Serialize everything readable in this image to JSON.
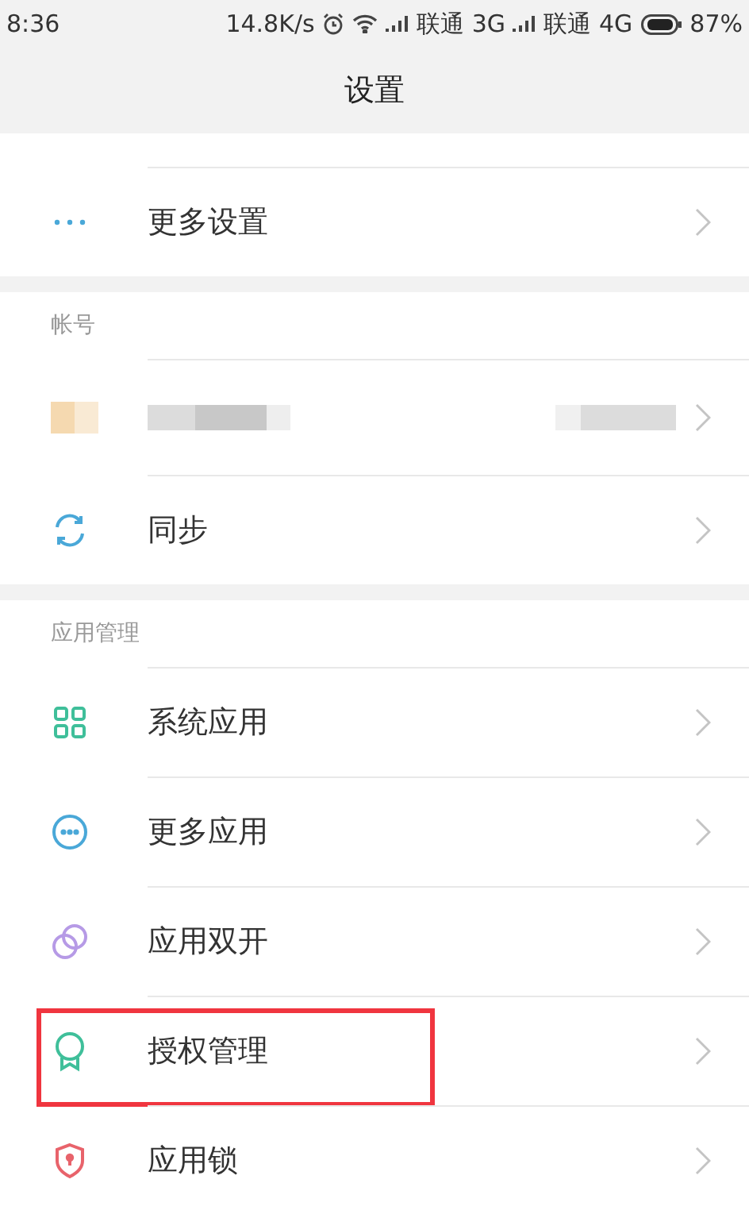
{
  "status_bar": {
    "time": "8:36",
    "speed": "14.8K/s",
    "carriers": [
      {
        "name": "联通",
        "network": "3G"
      },
      {
        "name": "联通",
        "network": "4G"
      }
    ],
    "battery": "87%"
  },
  "title": "设置",
  "sections": [
    {
      "rows": [
        {
          "kind": "link",
          "label": "更多设置",
          "highlighted": false
        }
      ]
    },
    {
      "header": "帐号",
      "rows": [
        {
          "kind": "account"
        },
        {
          "kind": "link",
          "label": "同步",
          "highlighted": false
        }
      ]
    },
    {
      "header": "应用管理",
      "rows": [
        {
          "kind": "link",
          "label": "系统应用",
          "highlighted": false
        },
        {
          "kind": "link",
          "label": "更多应用",
          "highlighted": false
        },
        {
          "kind": "link",
          "label": "应用双开",
          "highlighted": false
        },
        {
          "kind": "link",
          "label": "授权管理",
          "highlighted": true
        },
        {
          "kind": "link",
          "label": "应用锁",
          "highlighted": false
        }
      ]
    }
  ]
}
